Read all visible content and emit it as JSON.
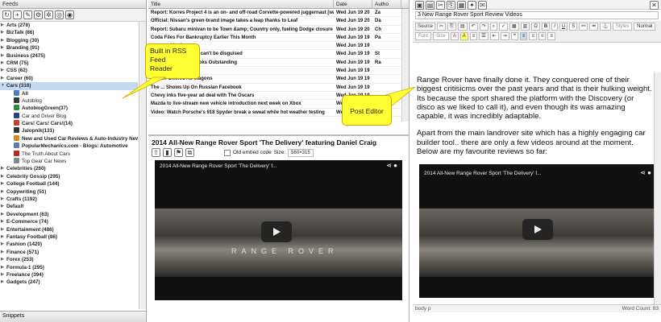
{
  "feeds": {
    "header": "Feeds",
    "items": [
      {
        "label": "Arts (278)",
        "t": "c"
      },
      {
        "label": "BizTalk (86)",
        "t": "c"
      },
      {
        "label": "Blogging (30)",
        "t": "c"
      },
      {
        "label": "Branding (91)",
        "t": "c"
      },
      {
        "label": "Business (2475)",
        "t": "c"
      },
      {
        "label": "CRM (75)",
        "t": "c"
      },
      {
        "label": "CSS (62)",
        "t": "c"
      },
      {
        "label": "Career (60)",
        "t": "c"
      },
      {
        "label": "Cars (316)",
        "t": "o"
      },
      {
        "label": "All",
        "t": "s",
        "c": "#4a7fc1"
      },
      {
        "label": "Autoblog",
        "t": "s",
        "c": "#3a3a3a",
        "thin": true
      },
      {
        "label": "AutoblogGreen(37)",
        "t": "s",
        "c": "#2e8b3b"
      },
      {
        "label": "Car and Driver Blog",
        "t": "s",
        "c": "#2a3f8f",
        "thin": true
      },
      {
        "label": "Cars! Cars! Cars!(14)",
        "t": "s",
        "c": "#d23a2a"
      },
      {
        "label": "Jalopnik(131)",
        "t": "s",
        "c": "#333"
      },
      {
        "label": "New and Used Car Reviews & Auto-Industry News",
        "t": "s",
        "c": "#d98a1a"
      },
      {
        "label": "PopularMechanics.com - Blogs: Automotive",
        "t": "s",
        "c": "#5a7fb5"
      },
      {
        "label": "The Truth About Cars",
        "t": "s",
        "c": "#c22",
        "thin": true
      },
      {
        "label": "Top Gear Car News",
        "t": "s",
        "c": "#888",
        "thin": true
      },
      {
        "label": "Celebrities (260)",
        "t": "c"
      },
      {
        "label": "Celebrity Gossip (295)",
        "t": "c"
      },
      {
        "label": "College Football (144)",
        "t": "c"
      },
      {
        "label": "Copywriting (51)",
        "t": "c"
      },
      {
        "label": "Crafts (1192)",
        "t": "c"
      },
      {
        "label": "Default",
        "t": "c"
      },
      {
        "label": "Development (63)",
        "t": "c"
      },
      {
        "label": "E-Commerce (74)",
        "t": "c"
      },
      {
        "label": "Entertainment (486)",
        "t": "c"
      },
      {
        "label": "Fantasy Football (86)",
        "t": "c"
      },
      {
        "label": "Fashion (1420)",
        "t": "c"
      },
      {
        "label": "Finance (571)",
        "t": "c"
      },
      {
        "label": "Forex (253)",
        "t": "c"
      },
      {
        "label": "Formula-1 (295)",
        "t": "c"
      },
      {
        "label": "Freelance (394)",
        "t": "c"
      },
      {
        "label": "Gadgets (247)",
        "t": "c"
      }
    ],
    "snippets": "Snippets"
  },
  "articles": {
    "cols": [
      "Title",
      "Date",
      "Autho"
    ],
    "rows": [
      [
        "Report: Korres Project 4 is an on- and off-road Corvette-powered juggernaut [w/video]",
        "Wed Jun 19 20",
        "Za"
      ],
      [
        "Official: Nissan's green-brand image takes a leap thanks to Leaf",
        "Wed Jun 19 20",
        "Da"
      ],
      [
        "Report: Subaru minivan to be Town &amp; Country only, fueling Dodge closure",
        "Wed Jun 19 20",
        "Ch"
      ],
      [
        "Coda Files For Bankruptcy Earlier This Month",
        "Wed Jun 19 19",
        "Pa"
      ],
      [
        "...an positioning",
        "Wed Jun 19 19",
        ""
      ],
      [
        "...Coupe proves sexy can't be disguised",
        "Wed Jun 19 19",
        "St"
      ],
      [
        "...ou Helped Make Looks Outstanding",
        "Wed Jun 19 19",
        "Ra"
      ],
      [
        "...spied in Russia",
        "Wed Jun 19 19",
        ""
      ],
      [
        "...Been Offered As Wagons",
        "Wed Jun 19 19",
        ""
      ],
      [
        "The ... Shows Up On Russian Facebook",
        "Wed Jun 19 19",
        ""
      ],
      [
        "Chevy inks five-year ad deal with The Oscars",
        "Wed Jun 19 19",
        ""
      ],
      [
        "Mazda to live-stream new vehicle introduction next week on Xbox",
        "Wed Jun 19 19",
        ""
      ],
      [
        "Video: Watch Porsche's 918 Spyder break a sweat while hot weather testing",
        "Wed Jun 19 19",
        ""
      ]
    ]
  },
  "preview": {
    "title": "2014 All-New Range Rover Sport 'The Delivery' featuring Daniel Craig",
    "embed_label": "Old embed code",
    "size_label": "Size:",
    "size_value": "560×315",
    "video_title": "2014 All-New Range Rover Sport 'The Delivery' f...",
    "brand": "RANGE ROVER"
  },
  "editor": {
    "title": "3 New Range Rover Sport Review Videos",
    "source": "Source",
    "styles": "Styles",
    "format": "Normal",
    "font": "Font",
    "size": "Size",
    "p1": "Range Rover have finally done it.  They conquered one of their biggest critisicms over the past years and that is their hulking weight.  Its because the sport shared the platform with the Discovery (or disco as we liked to call it), and even though its was amazing capable, it was incredibly adaptable.",
    "p2": "Apart from the main landrover site which has a highly engaging car builder tool.. there are only a few videos around at the moment. Below are my favourite reviews so far:",
    "video_title": "2014 All-New Range Rover Sport 'The Delivery' f...",
    "path": "body  p",
    "wordcount": "Word Count: 83"
  },
  "callouts": {
    "rss": "Built in RSS\nFeed\nReader",
    "post": "Post Editor"
  }
}
